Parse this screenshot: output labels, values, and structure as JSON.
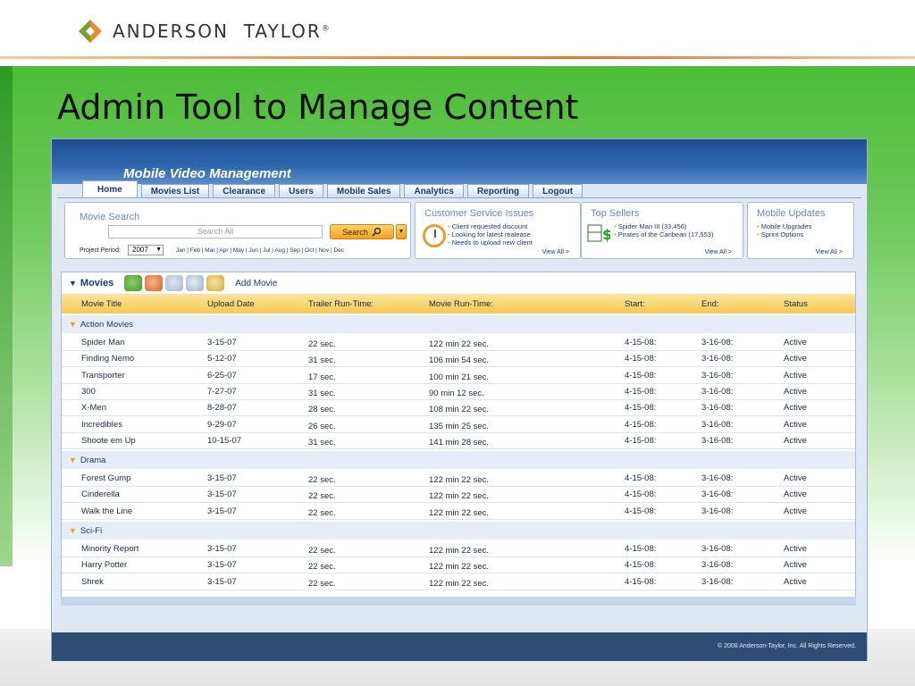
{
  "brand": {
    "name_part1": "ANDERSON",
    "name_part2": "TAYLOR",
    "reg_mark": "®"
  },
  "slide": {
    "title": "Admin Tool to Manage Content"
  },
  "app": {
    "title": "Mobile Video Management",
    "tabs": [
      {
        "label": "Home",
        "active": true
      },
      {
        "label": "Movies List"
      },
      {
        "label": "Clearance"
      },
      {
        "label": "Users"
      },
      {
        "label": "Mobile Sales"
      },
      {
        "label": "Analytics"
      },
      {
        "label": "Reporting"
      },
      {
        "label": "Logout"
      }
    ],
    "movie_search": {
      "title": "Movie Search",
      "placeholder": "Search All",
      "button_label": "Search",
      "project_period_label": "Project Period:",
      "project_period_value": "2007",
      "months": "Jan | Feb | Mar | Apr | May | Jun | Jul | Aug | Sep | Oct | Nov | Dec"
    },
    "customer_service": {
      "title": "Customer Service Issues",
      "items": [
        "Client requested discount",
        "Looking for latest realease",
        "Needs to upload new client"
      ],
      "view_all": "View All >"
    },
    "top_sellers": {
      "title": "Top Sellers",
      "items": [
        "Spider Man III (33,456)",
        "Pirates of the Caribean (17,553)"
      ],
      "view_all": "View All >"
    },
    "mobile_updates": {
      "title": "Mobile Updates",
      "items": [
        "Mobile Upgrades",
        "Sprint Options"
      ],
      "view_all": "View All >"
    },
    "movies": {
      "label": "Movies",
      "add_movie": "Add Movie",
      "columns": [
        "Movie Title",
        "Upload Date",
        "Trailer Run-Time:",
        "Movie Run-Time:",
        "Start:",
        "End:",
        "Status"
      ],
      "groups": [
        {
          "name": "Action Movies",
          "rows": [
            [
              "Spider Man",
              "3-15-07",
              "22 sec.",
              "122 min 22 sec.",
              "4-15-08:",
              "3-16-08:",
              "Active"
            ],
            [
              "Finding Nemo",
              "5-12-07",
              "31 sec.",
              "106 min 54 sec.",
              "4-15-08:",
              "3-16-08:",
              "Active"
            ],
            [
              "Transporter",
              "6-25-07",
              "17 sec.",
              "100 min 21 sec.",
              "4-15-08:",
              "3-16-08:",
              "Active"
            ],
            [
              "300",
              "7-27-07",
              "31 sec.",
              "90 min 12 sec.",
              "4-15-08:",
              "3-16-08:",
              "Active"
            ],
            [
              "X-Men",
              "8-28-07",
              "28 sec.",
              "108 min 22 sec.",
              "4-15-08:",
              "3-16-08:",
              "Active"
            ],
            [
              "Incredibles",
              "9-29-07",
              "26 sec.",
              "135 min 25 sec.",
              "4-15-08:",
              "3-16-08:",
              "Active"
            ],
            [
              "Shoote em Up",
              "10-15-07",
              "31 sec.",
              "141 min 28 sec.",
              "4-15-08:",
              "3-16-08:",
              "Active"
            ]
          ]
        },
        {
          "name": "Drama",
          "rows": [
            [
              "Forest Gump",
              "3-15-07",
              "22 sec.",
              "122 min 22 sec.",
              "4-15-08:",
              "3-16-08:",
              "Active"
            ],
            [
              "Cinderella",
              "3-15-07",
              "22 sec.",
              "122 min 22 sec.",
              "4-15-08:",
              "3-16-08:",
              "Active"
            ],
            [
              "Walk the Line",
              "3-15-07",
              "22 sec.",
              "122 min 22 sec.",
              "4-15-08:",
              "3-16-08:",
              "Active"
            ]
          ]
        },
        {
          "name": "Sci-Fi",
          "rows": [
            [
              "Minority Report",
              "3-15-07",
              "22 sec.",
              "122 min 22 sec.",
              "4-15-08:",
              "3-16-08:",
              "Active"
            ],
            [
              "Harry Potter",
              "3-15-07",
              "22 sec.",
              "122 min 22 sec.",
              "4-15-08:",
              "3-16-08:",
              "Active"
            ],
            [
              "Shrek",
              "3-15-07",
              "22 sec.",
              "122 min 22 sec.",
              "4-15-08:",
              "3-16-08:",
              "Active"
            ]
          ]
        }
      ]
    },
    "copyright": "© 2008 Anderson-Taylor, Inc. All Rights Reserved."
  },
  "colors": {
    "accent_orange": "#e67628",
    "header_blue": "#1d4e8f",
    "table_header": "#f7c853",
    "group_bg": "#e6edf6"
  }
}
